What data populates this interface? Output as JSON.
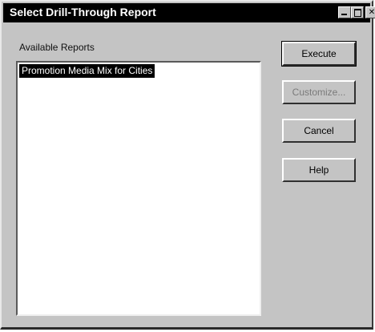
{
  "window": {
    "title": "Select Drill-Through Report"
  },
  "reports": {
    "label": "Available Reports",
    "items": [
      {
        "label": "Promotion Media Mix for Cities",
        "selected": true
      }
    ]
  },
  "buttons": {
    "execute": "Execute",
    "customize": "Customize...",
    "cancel": "Cancel",
    "help": "Help"
  },
  "colors": {
    "title_bar": "#000000",
    "selection": "#000000",
    "face": "#c4c4c4"
  }
}
